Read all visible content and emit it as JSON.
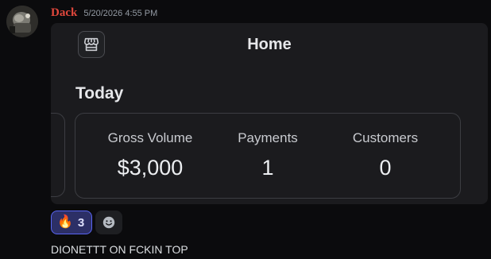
{
  "author": {
    "name": "Dack",
    "timestamp": "5/20/2026 4:55 PM",
    "name_color": "#e0473c"
  },
  "embed": {
    "title": "Home",
    "icon": "store-icon",
    "section_heading": "Today",
    "stats": [
      {
        "label": "Gross Volume",
        "value": "$3,000"
      },
      {
        "label": "Payments",
        "value": "1"
      },
      {
        "label": "Customers",
        "value": "0"
      }
    ]
  },
  "reactions": [
    {
      "emoji": "🔥",
      "count": "3",
      "icon": "fire-emoji",
      "selected": true
    }
  ],
  "add_reaction_icon": "smiley-icon",
  "message": {
    "text": "DIONETTT ON FCKIN TOP"
  }
}
